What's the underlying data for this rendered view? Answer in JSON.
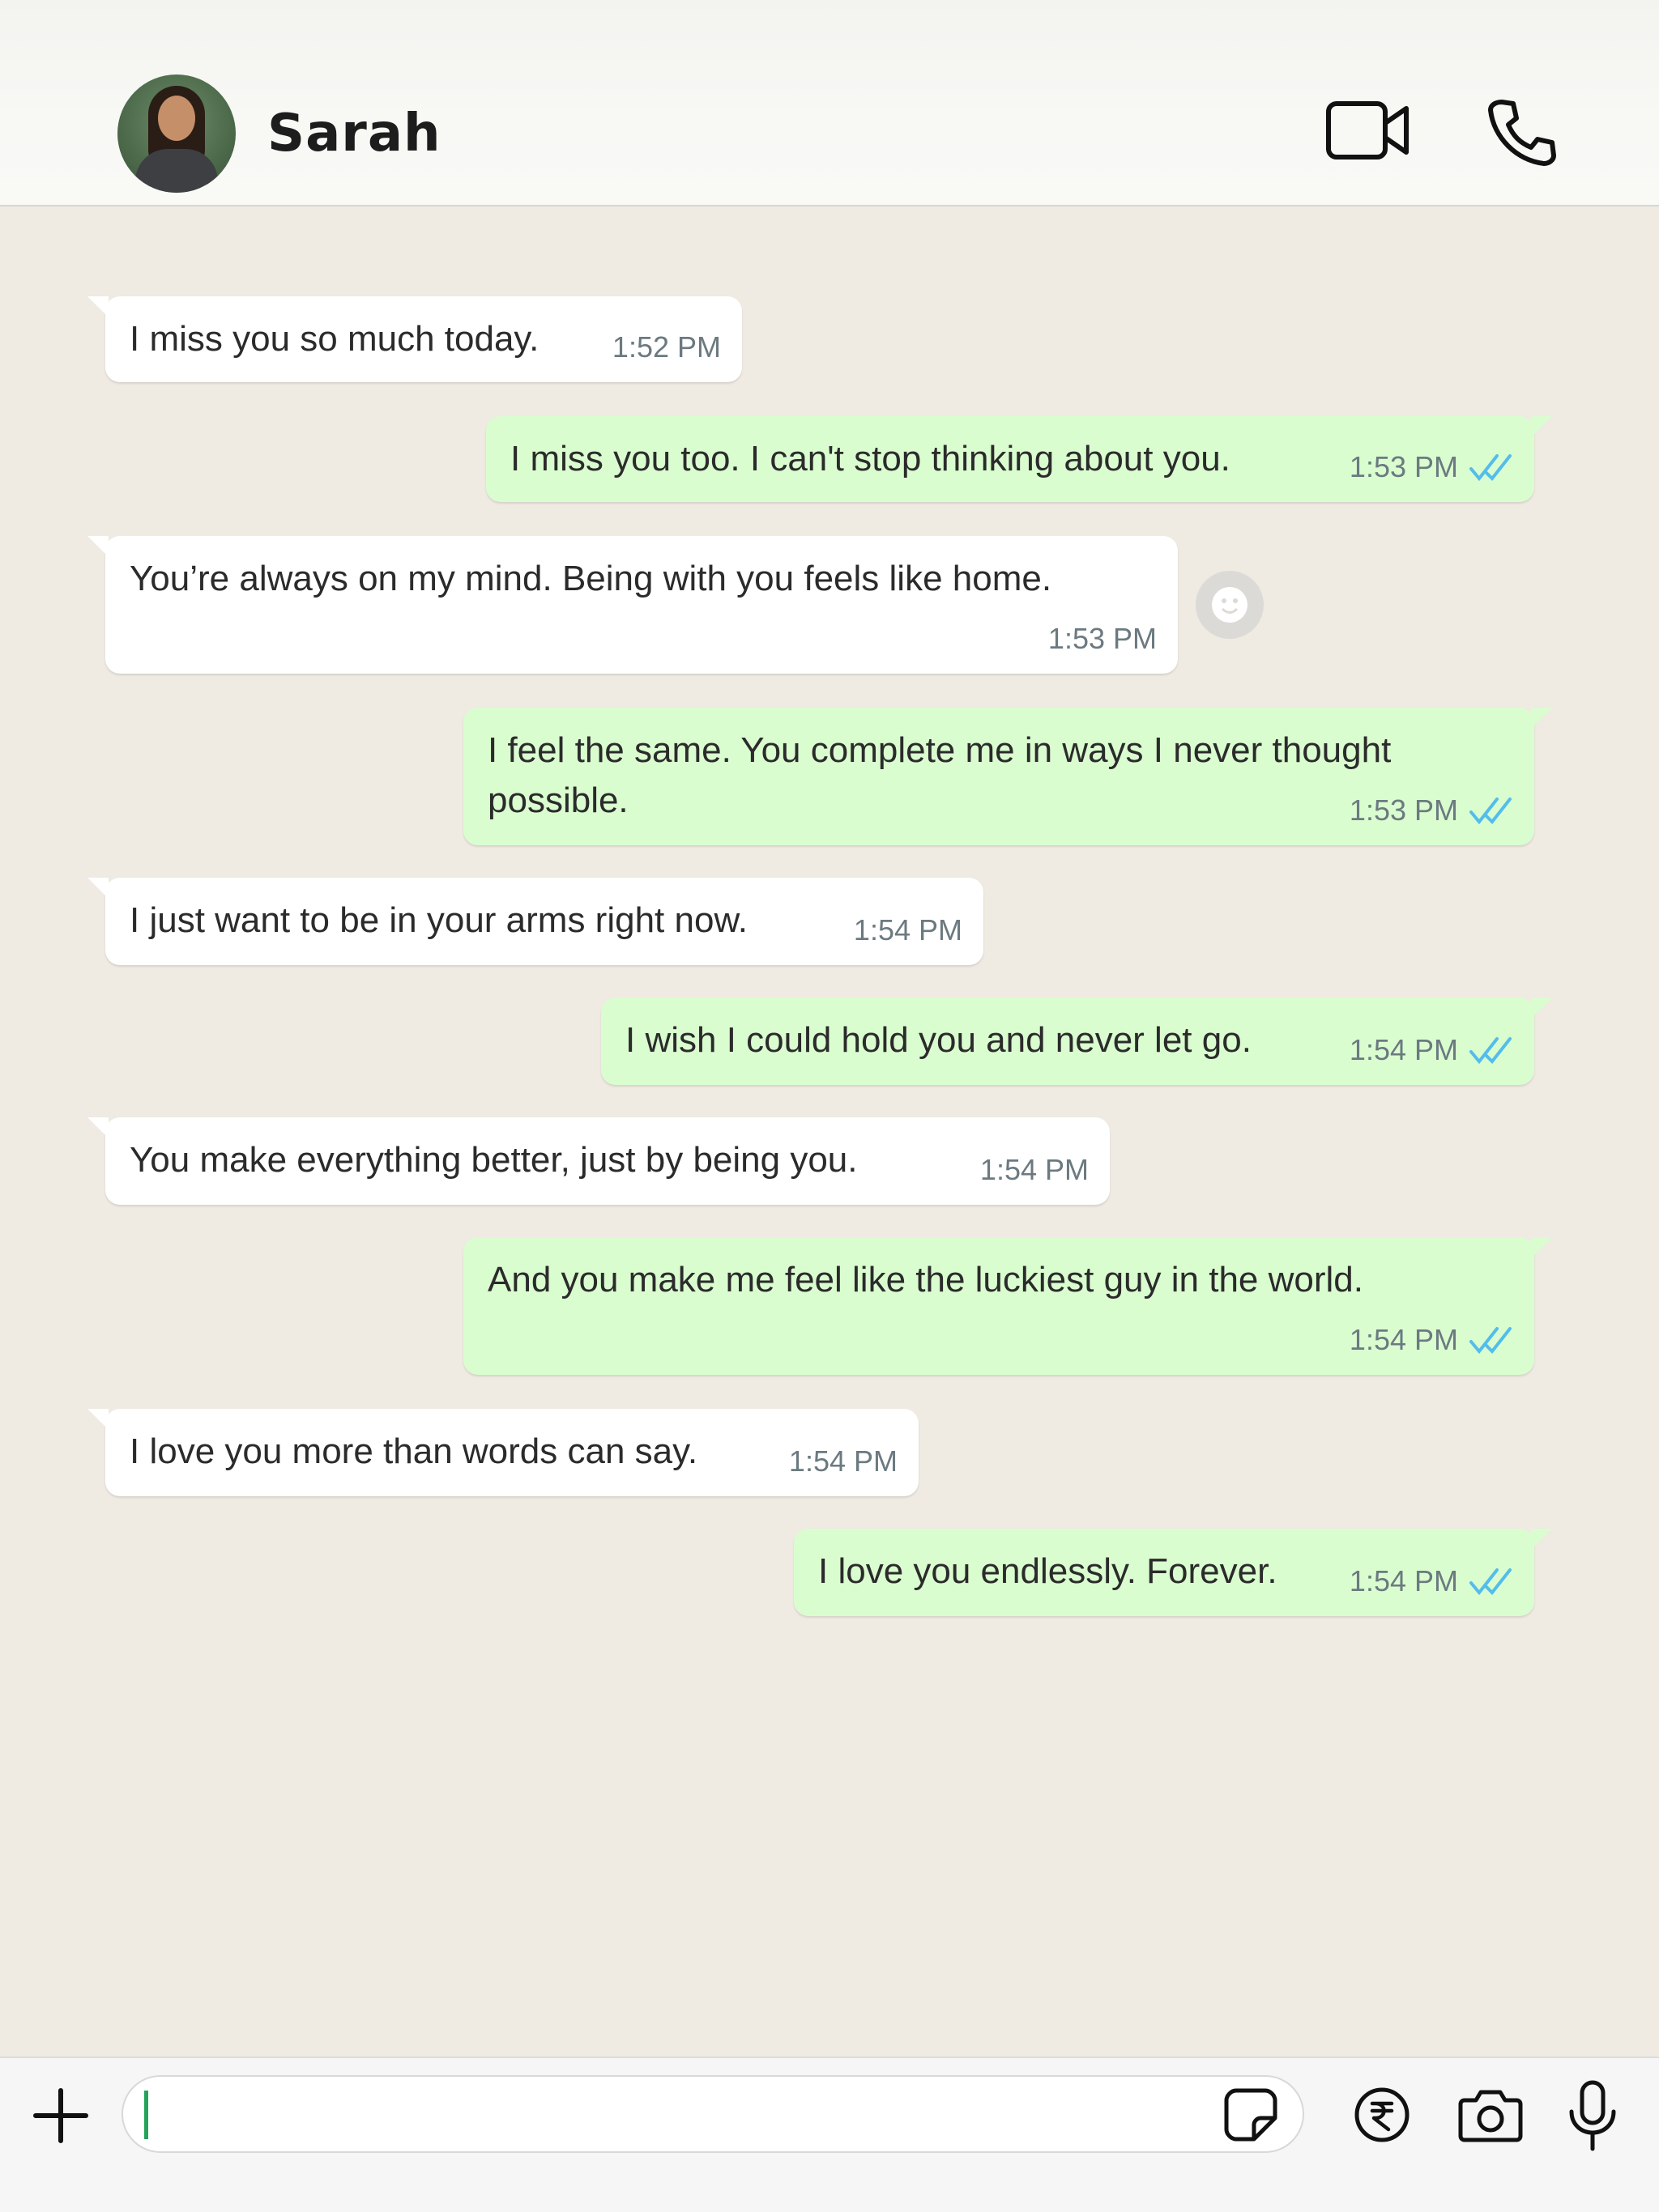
{
  "header": {
    "contact_name": "Sarah",
    "icons": [
      "video-call-icon",
      "voice-call-icon"
    ]
  },
  "messages": [
    {
      "direction": "incoming",
      "text": "I miss you so much today.",
      "time": "1:52 PM"
    },
    {
      "direction": "outgoing",
      "text": "I miss you too. I can't stop thinking about you.",
      "time": "1:53 PM",
      "status": "read"
    },
    {
      "direction": "incoming",
      "text": "You’re always on my mind. Being with you feels like home.",
      "time": "1:53 PM"
    },
    {
      "direction": "outgoing",
      "text": "I feel the same. You complete me in ways I never thought possible.",
      "time": "1:53 PM",
      "status": "read"
    },
    {
      "direction": "incoming",
      "text": "I just want to be in your arms right now.",
      "time": "1:54 PM"
    },
    {
      "direction": "outgoing",
      "text": "I wish I could hold you and never let go.",
      "time": "1:54 PM",
      "status": "read"
    },
    {
      "direction": "incoming",
      "text": "You make everything better, just by being you.",
      "time": "1:54 PM"
    },
    {
      "direction": "outgoing",
      "text": "And you make me feel like the luckiest guy in the world.",
      "time": "1:54 PM",
      "status": "read"
    },
    {
      "direction": "incoming",
      "text": "I love you more than words can say.",
      "time": "1:54 PM"
    },
    {
      "direction": "outgoing",
      "text": "I love you endlessly. Forever.",
      "time": "1:54 PM",
      "status": "read"
    }
  ],
  "composer": {
    "input_value": "",
    "icons": [
      "plus-icon",
      "sticker-icon",
      "rupee-payment-icon",
      "camera-icon",
      "microphone-icon"
    ]
  },
  "colors": {
    "incoming_bubble": "#ffffff",
    "outgoing_bubble": "#dafdd0",
    "chat_background": "#efeae2",
    "read_ticks": "#53bdeb",
    "caret": "#25a35a"
  }
}
